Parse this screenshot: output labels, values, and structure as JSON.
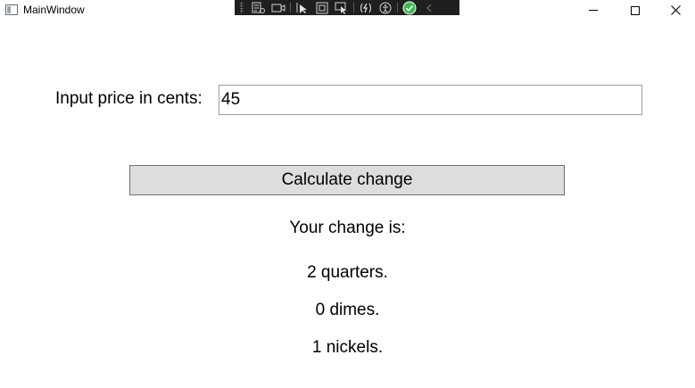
{
  "window": {
    "title": "MainWindow"
  },
  "form": {
    "price_label": "Input price in cents:",
    "price_value": "45",
    "calculate_label": "Calculate change"
  },
  "result": {
    "heading": "Your change is:",
    "quarters": "2 quarters.",
    "dimes": "0 dimes.",
    "nickels": "1 nickels."
  },
  "colors": {
    "button_bg": "#dddddd",
    "button_border": "#707070",
    "input_border": "#a0a0a0",
    "devbar_bg": "#1f1f1f",
    "check_green": "#3fb950"
  },
  "icons": {
    "titlebar": [
      "app-icon",
      "minimize-icon",
      "maximize-icon",
      "close-icon"
    ],
    "devbar": [
      "live-visual-tree-icon",
      "video-icon",
      "select-element-icon",
      "display-layout-adorners-icon",
      "track-focus-icon",
      "hot-reload-icon",
      "accessibility-icon",
      "binding-check-icon",
      "collapse-icon"
    ]
  }
}
